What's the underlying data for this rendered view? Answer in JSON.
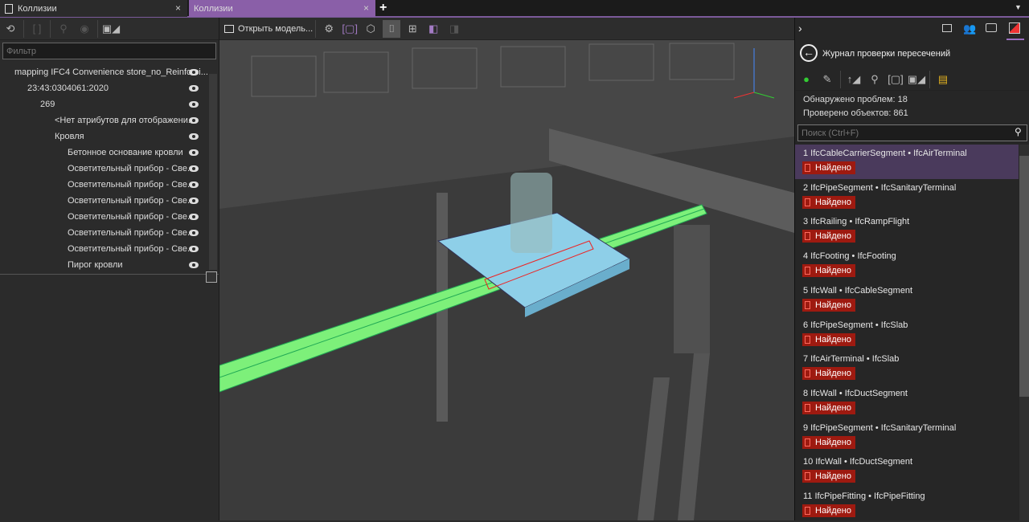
{
  "tabs": [
    {
      "label": "Коллизии",
      "active": false
    },
    {
      "label": "Коллизии",
      "active": true
    }
  ],
  "tab_add": "+",
  "tab_close": "×",
  "left": {
    "filter_placeholder": "Фильтр",
    "tree": [
      {
        "label": "mapping IFC4 Convenience store_no_Reinforci...",
        "indent": 0
      },
      {
        "label": "23:43:0304061:2020",
        "indent": 1
      },
      {
        "label": "269",
        "indent": 2
      },
      {
        "label": "<Нет атрибутов для отображени...",
        "indent": 3
      },
      {
        "label": "Кровля",
        "indent": 3
      },
      {
        "label": "Бетонное основание кровли",
        "indent": 4
      },
      {
        "label": "Осветительный прибор - Све...",
        "indent": 4
      },
      {
        "label": "Осветительный прибор - Све...",
        "indent": 4
      },
      {
        "label": "Осветительный прибор - Све...",
        "indent": 4
      },
      {
        "label": "Осветительный прибор - Све...",
        "indent": 4
      },
      {
        "label": "Осветительный прибор - Све...",
        "indent": 4
      },
      {
        "label": "Осветительный прибор - Све...",
        "indent": 4
      },
      {
        "label": "Пирог кровли",
        "indent": 4
      }
    ]
  },
  "viewport": {
    "open_model": "Открыть модель..."
  },
  "right": {
    "title": "Журнал проверки пересечений",
    "found": "Обнаружено проблем: 18",
    "checked": "Проверено объектов: 861",
    "search_placeholder": "Поиск (Ctrl+F)",
    "issues": [
      {
        "label": "1  IfcCableCarrierSegment • IfcAirTerminal",
        "status": "Найдено"
      },
      {
        "label": "2  IfcPipeSegment • IfcSanitaryTerminal",
        "status": "Найдено"
      },
      {
        "label": "3  IfcRailing • IfcRampFlight",
        "status": "Найдено"
      },
      {
        "label": "4  IfcFooting • IfcFooting",
        "status": "Найдено"
      },
      {
        "label": "5  IfcWall • IfcCableSegment",
        "status": "Найдено"
      },
      {
        "label": "6  IfcPipeSegment • IfcSlab",
        "status": "Найдено"
      },
      {
        "label": "7  IfcAirTerminal • IfcSlab",
        "status": "Найдено"
      },
      {
        "label": "8  IfcWall • IfcDuctSegment",
        "status": "Найдено"
      },
      {
        "label": "9  IfcPipeSegment • IfcSanitaryTerminal",
        "status": "Найдено"
      },
      {
        "label": "10  IfcWall • IfcDuctSegment",
        "status": "Найдено"
      },
      {
        "label": "11  IfcPipeFitting • IfcPipeFitting",
        "status": "Найдено"
      }
    ]
  },
  "colors": {
    "accent": "#7b5a9a",
    "selected": "#4a3a5c",
    "badge": "#9e1a10",
    "clash_green": "#7df07a",
    "clash_blue": "#8ecfe8"
  }
}
